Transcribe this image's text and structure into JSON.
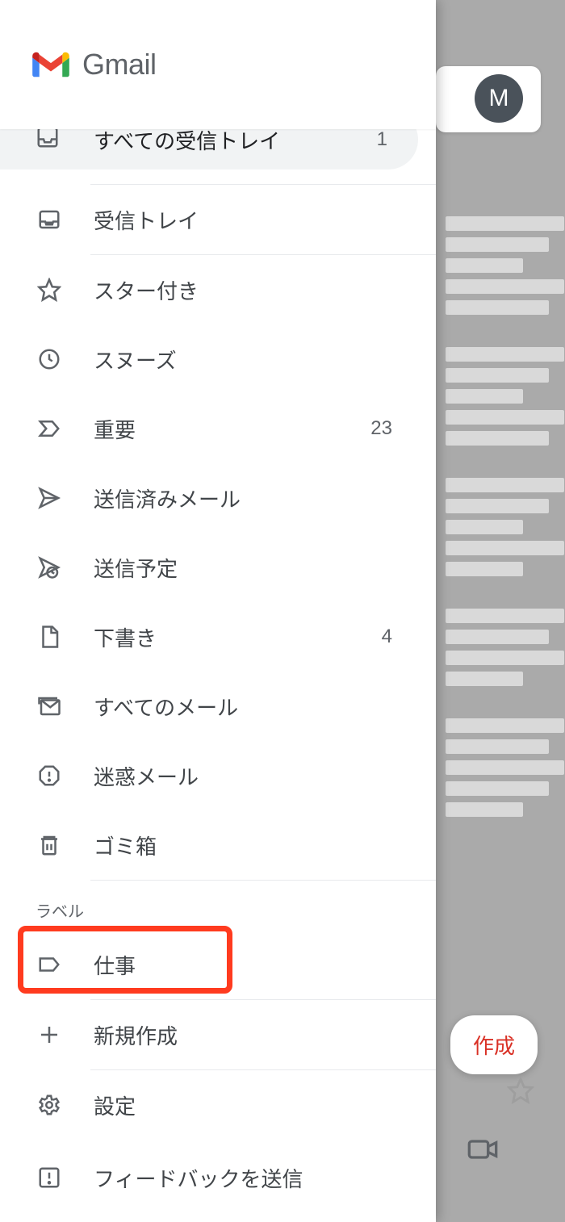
{
  "header": {
    "app_title": "Gmail"
  },
  "avatar": {
    "initial": "M"
  },
  "compose_peek": {
    "label_fragment": "作成"
  },
  "sidebar": {
    "selected": {
      "label": "すべての受信トレイ",
      "count": "1"
    },
    "items": [
      {
        "id": "inbox",
        "label": "受信トレイ",
        "count": ""
      },
      {
        "id": "starred",
        "label": "スター付き",
        "count": ""
      },
      {
        "id": "snoozed",
        "label": "スヌーズ",
        "count": ""
      },
      {
        "id": "important",
        "label": "重要",
        "count": "23"
      },
      {
        "id": "sent",
        "label": "送信済みメール",
        "count": ""
      },
      {
        "id": "scheduled",
        "label": "送信予定",
        "count": ""
      },
      {
        "id": "drafts",
        "label": "下書き",
        "count": "4"
      },
      {
        "id": "allmail",
        "label": "すべてのメール",
        "count": ""
      },
      {
        "id": "spam",
        "label": "迷惑メール",
        "count": ""
      },
      {
        "id": "trash",
        "label": "ゴミ箱",
        "count": ""
      }
    ],
    "labels_header": "ラベル",
    "labels": [
      {
        "id": "work",
        "label": "仕事"
      }
    ],
    "create_new": "新規作成",
    "settings": "設定",
    "feedback": "フィードバックを送信"
  }
}
